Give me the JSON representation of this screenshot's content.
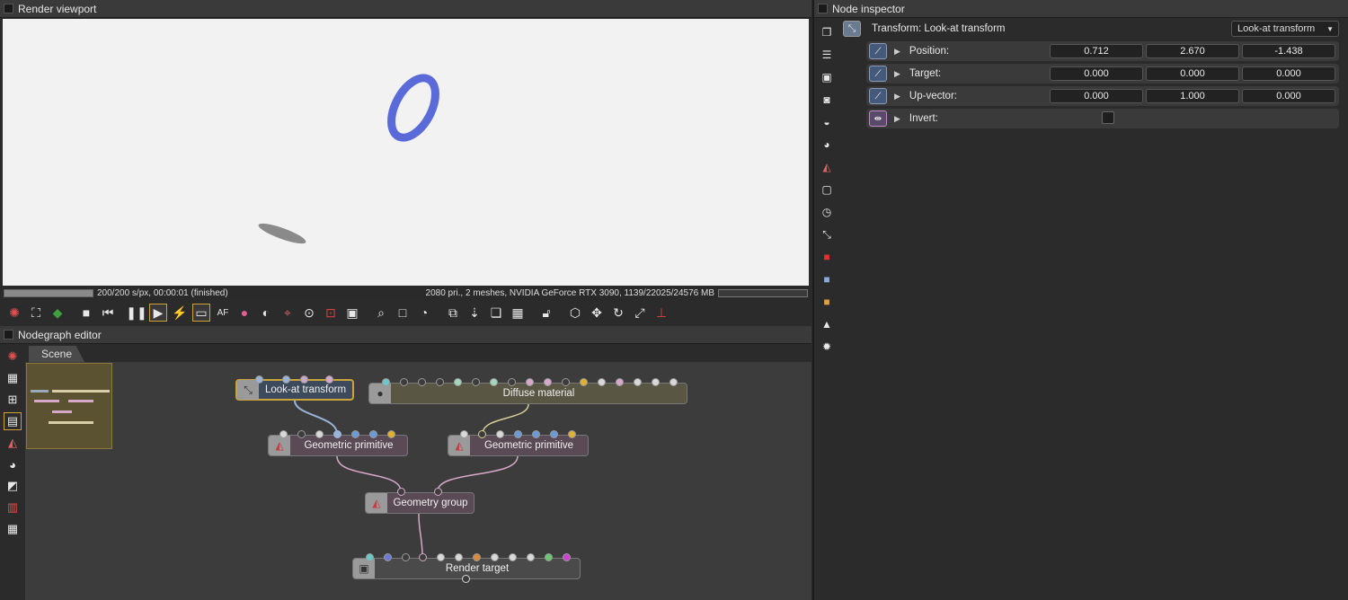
{
  "viewport": {
    "title": "Render viewport",
    "status_left": "200/200 s/px, 00:00:01 (finished)",
    "status_right": "2080 pri., 2 meshes, NVIDIA GeForce RTX 3090, 1139/22025/24576 MB",
    "render_progress": 1.0
  },
  "nodegraph": {
    "title": "Nodegraph editor",
    "tab": "Scene",
    "nodes": {
      "lookat": "Look-at transform",
      "diffuse": "Diffuse material",
      "geo1": "Geometric primitive",
      "geo2": "Geometric primitive",
      "group": "Geometry group",
      "render": "Render target"
    }
  },
  "inspector": {
    "title": "Node inspector",
    "node_title": "Transform: Look-at transform",
    "type_dropdown": "Look-at transform",
    "rows": [
      {
        "label": "Position:",
        "values": [
          "0.712",
          "2.670",
          "-1.438"
        ]
      },
      {
        "label": "Target:",
        "values": [
          "0.000",
          "0.000",
          "0.000"
        ]
      },
      {
        "label": "Up-vector:",
        "values": [
          "0.000",
          "1.000",
          "0.000"
        ]
      },
      {
        "label": "Invert:",
        "checked": false
      }
    ]
  },
  "colors": {
    "accent": "#c9a43a",
    "ring": "#5a6ad8",
    "viewport_bg": "#f2f2f2"
  }
}
